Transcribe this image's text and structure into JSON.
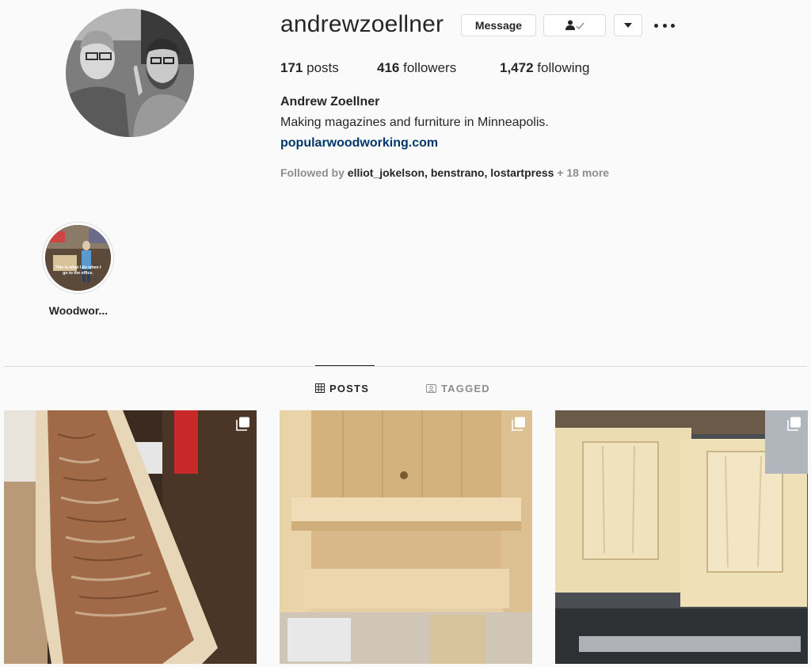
{
  "profile": {
    "username": "andrewzoellner",
    "message_label": "Message",
    "posts_count": "171",
    "posts_label": "posts",
    "followers_count": "416",
    "followers_label": "followers",
    "following_count": "1,472",
    "following_label": "following",
    "full_name": "Andrew Zoellner",
    "bio": "Making magazines and furniture in Minneapolis.",
    "website": "popularwoodworking.com",
    "followed_by_prefix": "Followed by",
    "followed_by_users": [
      "elliot_jokelson",
      "benstrano",
      "lostartpress"
    ],
    "followed_by_suffix": "+ 18 more"
  },
  "highlights": [
    {
      "label": "Woodwor...",
      "overlay_text": "This is what I do when I go to the office."
    }
  ],
  "tabs": [
    {
      "label": "POSTS",
      "icon": "grid-icon",
      "active": true
    },
    {
      "label": "TAGGED",
      "icon": "tagged-icon",
      "active": false
    }
  ],
  "posts": [
    {
      "subject": "rough sawn log with bark",
      "multi": true
    },
    {
      "subject": "pine shelf cabinet",
      "multi": true
    },
    {
      "subject": "two raised panel doors",
      "multi": true
    }
  ],
  "colors": {
    "background": "#fafafa",
    "text": "#262626",
    "muted": "#8e8e8e",
    "link": "#00376b",
    "border": "#dbdbdb"
  }
}
